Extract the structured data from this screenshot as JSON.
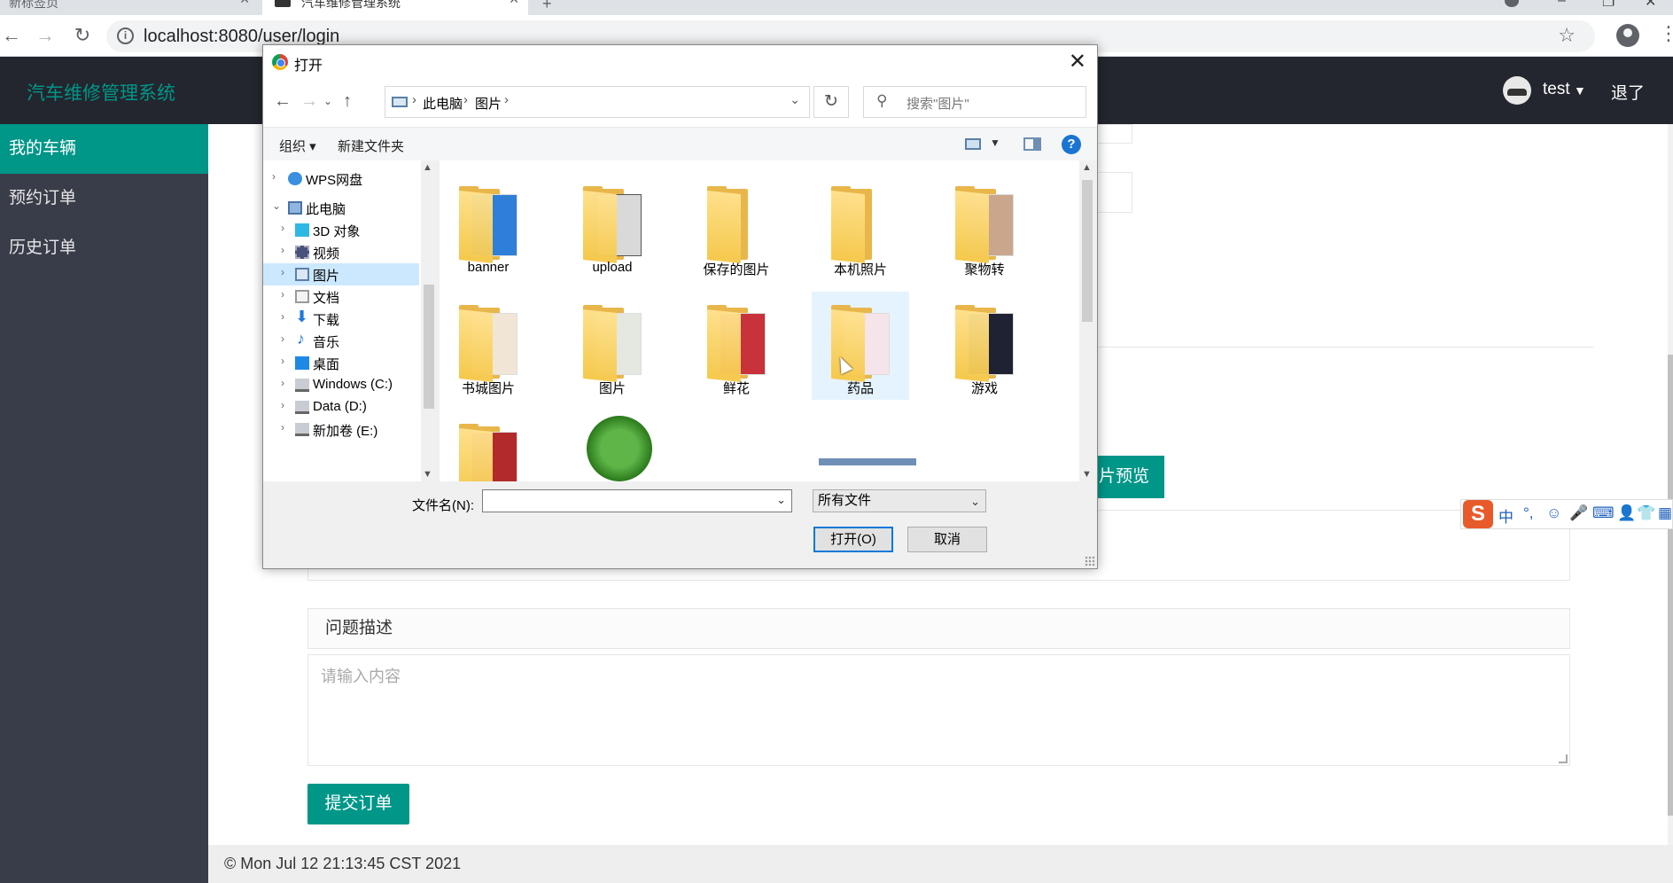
{
  "browser": {
    "tabs": [
      {
        "title": "新标签页"
      },
      {
        "title": "汽车维修管理系统"
      }
    ],
    "url": "localhost:8080/user/login"
  },
  "app": {
    "logo": "汽车维修管理系统",
    "user": {
      "name": "test",
      "logout": "退了"
    },
    "sidebar": {
      "items": [
        {
          "label": "我的车辆",
          "active": true
        },
        {
          "label": "预约订单"
        },
        {
          "label": "历史订单"
        }
      ]
    },
    "form": {
      "preview_button": "片预览",
      "desc_label": "问题描述",
      "desc_placeholder": "请输入内容",
      "submit_button": "提交订单"
    },
    "footer": "© Mon Jul 12 21:13:45 CST 2021"
  },
  "ime": {
    "items": [
      "中",
      "°,",
      "☺",
      "🎤",
      "⌨",
      "👤",
      "👕",
      "▦"
    ]
  },
  "dialog": {
    "title": "打开",
    "breadcrumb": [
      "此电脑",
      "图片"
    ],
    "search_placeholder": "搜索\"图片\"",
    "commands": {
      "organize": "组织 ▾",
      "new_folder": "新建文件夹"
    },
    "tree": [
      {
        "label": "WPS网盘",
        "level": 0,
        "expanded": false
      },
      {
        "label": "此电脑",
        "level": 0,
        "expanded": true
      },
      {
        "label": "3D 对象",
        "level": 1
      },
      {
        "label": "视频",
        "level": 1
      },
      {
        "label": "图片",
        "level": 1,
        "selected": true
      },
      {
        "label": "文档",
        "level": 1
      },
      {
        "label": "下载",
        "level": 1
      },
      {
        "label": "音乐",
        "level": 1
      },
      {
        "label": "桌面",
        "level": 1
      },
      {
        "label": "Windows (C:)",
        "level": 1
      },
      {
        "label": "Data (D:)",
        "level": 1
      },
      {
        "label": "新加卷 (E:)",
        "level": 1
      }
    ],
    "files": [
      {
        "name": "banner"
      },
      {
        "name": "upload"
      },
      {
        "name": "保存的图片"
      },
      {
        "name": "本机照片"
      },
      {
        "name": "聚物转"
      },
      {
        "name": "书城图片"
      },
      {
        "name": "图片"
      },
      {
        "name": "鲜花"
      },
      {
        "name": "药品",
        "hovered": true
      },
      {
        "name": "游戏"
      }
    ],
    "filename_label": "文件名(N):",
    "filename_value": "",
    "file_type": "所有文件",
    "open_button": "打开(O)",
    "cancel_button": "取消"
  }
}
